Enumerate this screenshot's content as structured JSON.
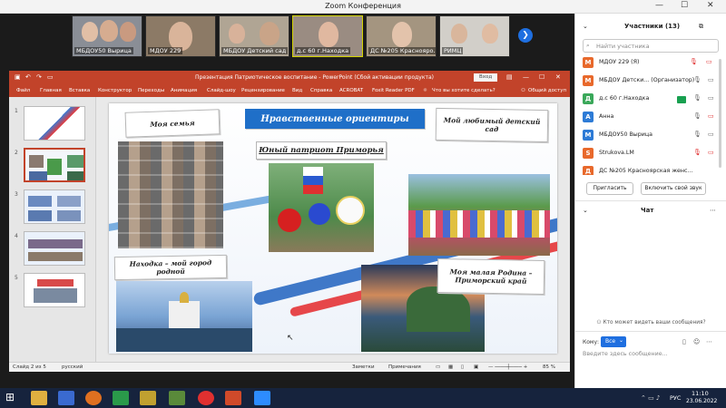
{
  "window": {
    "title": "Zoom Конференция",
    "minimize": "—",
    "maximize": "☐",
    "close": "✕"
  },
  "thumbnails": [
    {
      "name": "МБДОУ50 Вырица"
    },
    {
      "name": "МДОУ 229"
    },
    {
      "name": "МБДОУ Детский сад"
    },
    {
      "name": "д.с 60 г.Находка"
    },
    {
      "name": "ДС №205 Краснояро..."
    },
    {
      "name": "РИМЦ"
    }
  ],
  "next_icon": "chevron-right-icon",
  "ppt": {
    "title": "Презентация Патриотическое воспитание  -  PowerPoint (Сбой активации продукта)",
    "login_label": "Вход",
    "menu": [
      "Файл",
      "Главная",
      "Вставка",
      "Конструктор",
      "Переходы",
      "Анимация",
      "Слайд-шоу",
      "Рецензирование",
      "Вид",
      "Справка",
      "ACROBAT",
      "Foxit Reader PDF",
      "Что вы хотите сделать?",
      "Общий доступ"
    ],
    "slide_numbers": [
      "1",
      "2",
      "3",
      "4",
      "5"
    ],
    "status": {
      "slide": "Слайд 2 из 5",
      "lang": "русский",
      "notes": "Заметки",
      "comments": "Примечания",
      "zoom": "85 %"
    }
  },
  "slide": {
    "title": "Нравственные ориентиры",
    "family": "Моя семья",
    "patriot": "Юный патриот Приморья",
    "kindergarten": "Мой любимый детский сад",
    "nakhodka": "Находка – мой город родной",
    "homeland": "Моя малая Родина – Приморский край"
  },
  "participants": {
    "header": "Участники (13)",
    "search_placeholder": "Найти участника",
    "list": [
      {
        "letter": "М",
        "name": "МДОУ 229 (Я)",
        "color": "#e8692c"
      },
      {
        "letter": "М",
        "name": "МБДОУ Детски... (Организатор)",
        "color": "#e8692c"
      },
      {
        "letter": "Д",
        "name": "д.с 60 г.Находка",
        "color": "#3aa85a"
      },
      {
        "letter": "А",
        "name": "Анна",
        "color": "#2d7bd6"
      },
      {
        "letter": "М",
        "name": "МБДОУ50 Вырица",
        "color": "#2d7bd6"
      },
      {
        "letter": "S",
        "name": "Strukova.LM",
        "color": "#e8692c"
      },
      {
        "letter": "Д",
        "name": "ДС №205 Красноярская женс...",
        "color": "#e8692c"
      }
    ],
    "invite_label": "Пригласить",
    "unmute_label": "Включить свой звук"
  },
  "chat": {
    "header": "Чат",
    "visibility": "Кто может видеть ваши сообщения?",
    "to_label": "Кому:",
    "to_value": "Все",
    "placeholder": "Введите здесь сообщение..."
  },
  "taskbar": {
    "lang": "РУС",
    "time": "11:10",
    "date": "23.06.2022"
  }
}
